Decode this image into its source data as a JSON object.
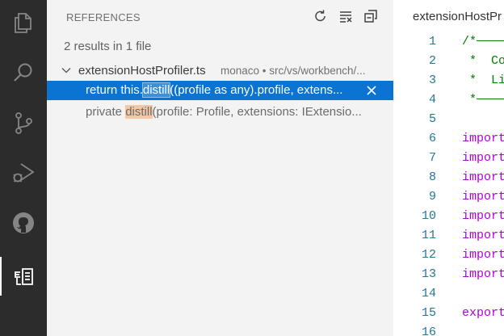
{
  "activity_bar": {
    "items": [
      "explorer-icon",
      "search-icon",
      "source-control-icon",
      "run-debug-icon",
      "github-icon",
      "references-icon"
    ],
    "active": "references-icon"
  },
  "references_panel": {
    "title": "REFERENCES",
    "actions": [
      "refresh-icon",
      "clear-icon",
      "collapse-all-icon"
    ],
    "summary": "2 results in 1 file",
    "file": {
      "name": "extensionHostProfiler.ts",
      "path": "monaco • src/vs/workbench/..."
    },
    "results": [
      {
        "before": "return this.",
        "match": "distill",
        "after": "((profile as any).profile, extens...",
        "selected": true
      },
      {
        "before": "private ",
        "match": "distill",
        "after": "(profile: Profile, extensions: IExtensio...",
        "selected": false
      }
    ]
  },
  "editor": {
    "tab_title": "extensionHostPr",
    "lines": [
      {
        "n": "1",
        "text": "/*──────",
        "style": "comment"
      },
      {
        "n": "2",
        "text": " *  Co",
        "style": "comment"
      },
      {
        "n": "3",
        "text": " *  Li",
        "style": "comment"
      },
      {
        "n": "4",
        "text": " *──────",
        "style": "comment"
      },
      {
        "n": "5",
        "text": "",
        "style": "plain"
      },
      {
        "n": "6",
        "text": "import",
        "style": "kw"
      },
      {
        "n": "7",
        "text": "import",
        "style": "kw"
      },
      {
        "n": "8",
        "text": "import",
        "style": "kw"
      },
      {
        "n": "9",
        "text": "import",
        "style": "kw"
      },
      {
        "n": "10",
        "text": "import",
        "style": "kw"
      },
      {
        "n": "11",
        "text": "import",
        "style": "kw"
      },
      {
        "n": "12",
        "text": "import",
        "style": "kw"
      },
      {
        "n": "13",
        "text": "import",
        "style": "kw"
      },
      {
        "n": "14",
        "text": "",
        "style": "plain"
      },
      {
        "n": "15",
        "text": "export",
        "style": "kw"
      },
      {
        "n": "16",
        "text": "",
        "style": "plain"
      }
    ]
  }
}
